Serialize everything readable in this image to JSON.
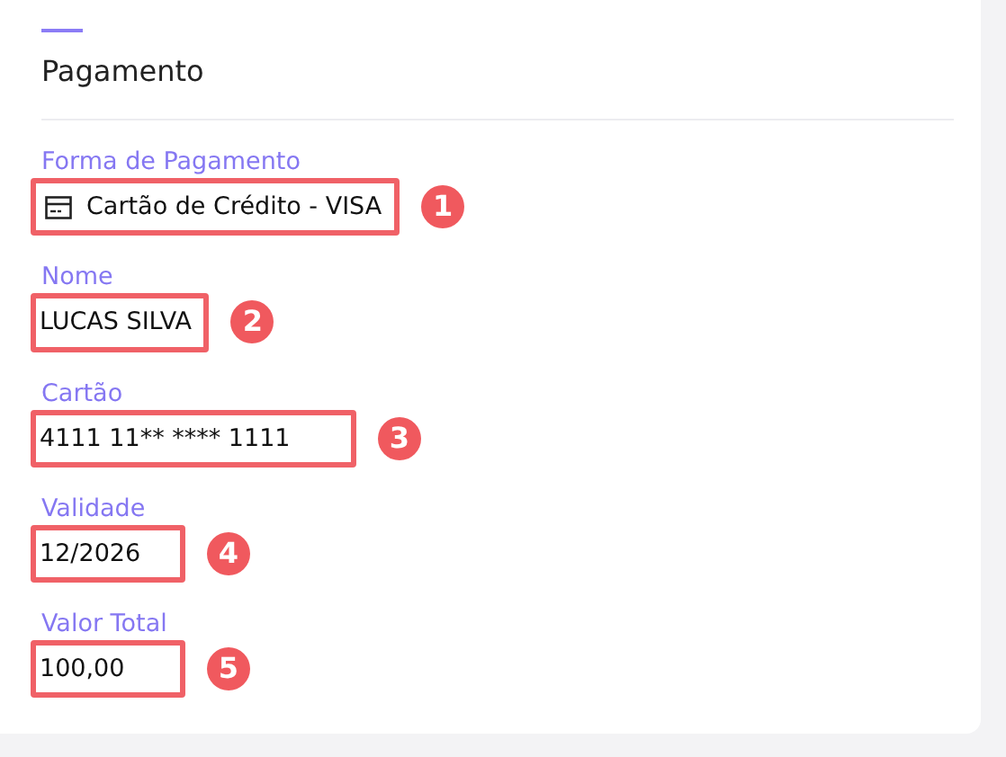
{
  "section": {
    "title": "Pagamento"
  },
  "fields": [
    {
      "kind": "select",
      "label": "Forma de Pagamento",
      "value": "Cartão de Crédito - VISA",
      "marker": "1"
    },
    {
      "kind": "text",
      "label": "Nome",
      "value": "LUCAS SILVA",
      "marker": "2"
    },
    {
      "kind": "text",
      "label": "Cartão",
      "value": "4111 11** **** 1111",
      "marker": "3"
    },
    {
      "kind": "text",
      "label": "Validade",
      "value": "12/2026",
      "marker": "4"
    },
    {
      "kind": "text",
      "label": "Valor Total",
      "value": "100,00",
      "marker": "5"
    }
  ]
}
